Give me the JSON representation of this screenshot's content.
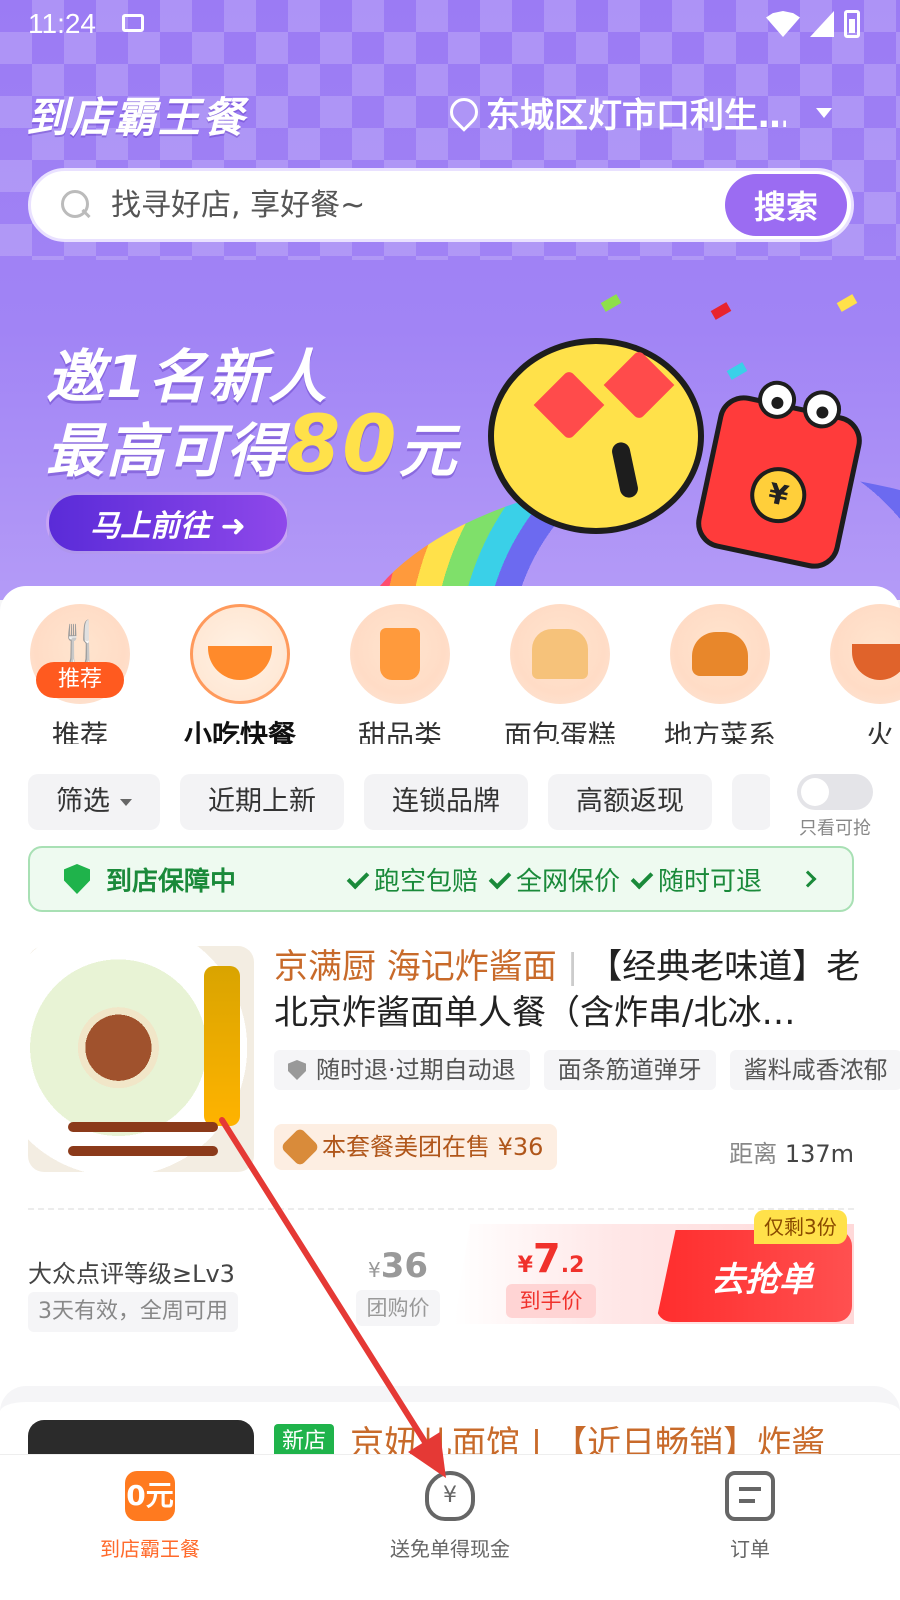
{
  "status_bar": {
    "time": "11:24"
  },
  "header": {
    "app_title": "到店霸王餐",
    "location": "东城区灯市口利生…",
    "search_placeholder": "找寻好店, 享好餐~",
    "search_button": "搜索"
  },
  "banner": {
    "line1": "邀1名新人",
    "line2_prefix": "最高可得",
    "line2_amount": "80",
    "line2_suffix": "元",
    "button": "马上前往 ➜",
    "coin_symbol": "¥"
  },
  "categories": [
    {
      "label": "推荐",
      "badge": "推荐",
      "icon": "fork-spoon-icon"
    },
    {
      "label": "小吃快餐",
      "icon": "noodle-bowl-icon",
      "active": true
    },
    {
      "label": "甜品类",
      "icon": "dessert-cup-icon"
    },
    {
      "label": "面包蛋糕",
      "icon": "bread-cake-icon"
    },
    {
      "label": "地方菜系",
      "icon": "burger-drink-icon"
    },
    {
      "label": "火",
      "icon": "hotpot-icon"
    }
  ],
  "filters": [
    "筛选",
    "近期上新",
    "连锁品牌",
    "高额返现"
  ],
  "toggle_label": "只看可抢",
  "guarantee": {
    "title": "到店保障中",
    "items": [
      "跑空包赔",
      "全网保价",
      "随时可退"
    ]
  },
  "deal": {
    "shop_name": "京满厨 海记炸酱面",
    "title": "【经典老味道】老北京炸酱面单人餐（含炸串/北冰…",
    "tags": [
      "随时退·过期自动退",
      "面条筋道弹牙",
      "酱料咸香浓郁"
    ],
    "meituan_note": "本套餐美团在售 ¥36",
    "distance_label": "距离",
    "distance_value": "137m",
    "level": "大众点评等级≥Lv3",
    "validity": "3天有效，全周可用",
    "group_price_yen": "¥",
    "group_price": "36",
    "group_price_label": "团购价",
    "final_yen": "¥",
    "final_int": "7",
    "final_dec": ".2",
    "final_label": "到手价",
    "stock": "仅剩3份",
    "grab_button": "去抢单"
  },
  "deal2": {
    "badge": "新店",
    "title": "京妞儿面馆 | 【近日畅销】炸酱"
  },
  "bottom_nav": [
    {
      "label": "到店霸王餐",
      "icon_text": "0元",
      "icon": "zero-yuan-icon",
      "active": true
    },
    {
      "label": "送免单得现金",
      "icon_text": "¥",
      "icon": "money-bag-icon"
    },
    {
      "label": "订单",
      "icon": "order-list-icon"
    }
  ],
  "colors": {
    "brand_purple": "#9b6cf2",
    "accent_orange": "#ff6a2b",
    "price_red": "#f0312b",
    "guarantee_green": "#1a8a3a",
    "annotation_arrow": "#e53935"
  }
}
